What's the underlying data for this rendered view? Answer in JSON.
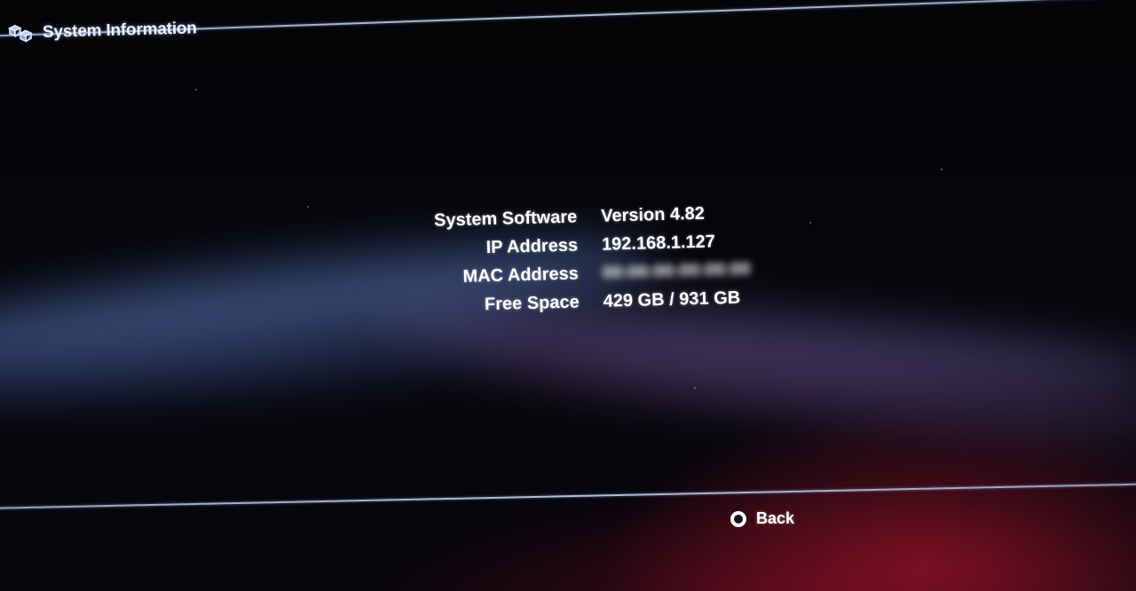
{
  "header": {
    "title": "System Information",
    "icon": "system-info-icon"
  },
  "info": {
    "rows": [
      {
        "label": "System Software",
        "value": "Version 4.82"
      },
      {
        "label": "IP Address",
        "value": "192.168.1.127"
      },
      {
        "label": "MAC Address",
        "value": "00:00:00:00:00:00",
        "obscured": true
      },
      {
        "label": "Free Space",
        "value": "429 GB / 931 GB"
      }
    ]
  },
  "footer": {
    "back_label": "Back",
    "back_icon": "circle-button-icon"
  },
  "colors": {
    "background": "#030306",
    "rule": "#b4c4e8",
    "text": "#ffffff",
    "wave_blue": "#5a78be",
    "wave_red": "#96122a"
  }
}
